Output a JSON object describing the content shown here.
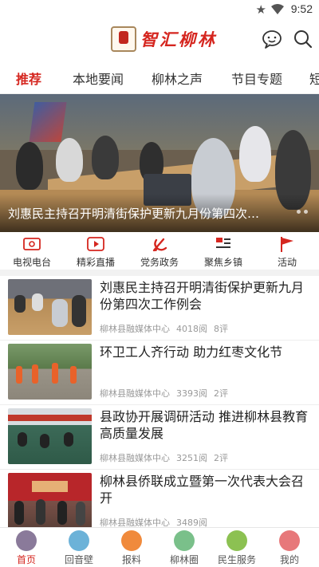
{
  "status_bar": {
    "time": "9:52"
  },
  "header": {
    "app_title": "智汇柳林",
    "logo_caption": "智汇柳林"
  },
  "tabs": [
    {
      "label": "推荐",
      "active": true
    },
    {
      "label": "本地要闻"
    },
    {
      "label": "柳林之声"
    },
    {
      "label": "节目专题"
    },
    {
      "label": "短"
    }
  ],
  "banner": {
    "caption": "刘惠民主持召开明清街保护更新九月份第四次工作例会"
  },
  "quick_nav": [
    {
      "label": "电视电台",
      "icon": "tv-radio-icon"
    },
    {
      "label": "精彩直播",
      "icon": "live-play-icon"
    },
    {
      "label": "党务政务",
      "icon": "party-emblem-icon"
    },
    {
      "label": "聚焦乡镇",
      "icon": "township-icon"
    },
    {
      "label": "活动",
      "icon": "flag-icon"
    }
  ],
  "news": [
    {
      "title": "刘惠民主持召开明清街保护更新九月份第四次工作例会",
      "source": "柳林县融媒体中心",
      "reads": "4018阅",
      "comments": "8评"
    },
    {
      "title": "环卫工人齐行动 助力红枣文化节",
      "source": "柳林县融媒体中心",
      "reads": "3393阅",
      "comments": "2评"
    },
    {
      "title": "县政协开展调研活动 推进柳林县教育高质量发展",
      "source": "柳林县融媒体中心",
      "reads": "3251阅",
      "comments": "2评"
    },
    {
      "title": "柳林县侨联成立暨第一次代表大会召开",
      "source": "柳林县融媒体中心",
      "reads": "3489阅",
      "comments": ""
    }
  ],
  "bottom_nav": [
    {
      "label": "首页",
      "active": true,
      "color": "#8a7a9a"
    },
    {
      "label": "回音壁",
      "color": "#6cb2d8"
    },
    {
      "label": "报料",
      "color": "#f08a3c"
    },
    {
      "label": "柳林圈",
      "color": "#7ac08a"
    },
    {
      "label": "民生服务",
      "color": "#8cc152"
    },
    {
      "label": "我的",
      "color": "#e7787a"
    }
  ],
  "colors": {
    "accent": "#d5261f"
  }
}
